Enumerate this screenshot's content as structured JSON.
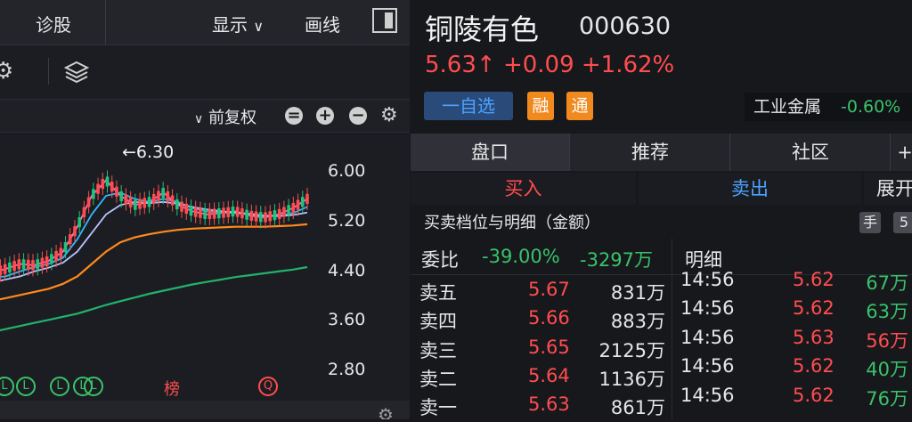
{
  "toolbar": {
    "diagnose_label": "诊股",
    "display_label": "显示",
    "draw_label": "画线",
    "price_adjust_label": "前复权"
  },
  "chart": {
    "high_label": "←6.30",
    "y_ticks": [
      "6.00",
      "5.20",
      "4.40",
      "3.60",
      "2.80"
    ],
    "event_markers": [
      "L",
      "L",
      "L",
      "L",
      "L",
      "榜",
      "Q"
    ]
  },
  "chart_data": {
    "type": "candlestick",
    "ylim": [
      2.8,
      6.4
    ],
    "y_ticks": [
      6.0,
      5.2,
      4.4,
      3.6,
      2.8
    ],
    "annotations": [
      "←6.30"
    ],
    "series": [
      {
        "values": [
          4.35,
          4.42,
          4.5,
          4.48,
          4.55,
          4.7,
          5.1,
          5.6,
          5.85,
          5.6,
          5.45,
          5.5,
          5.65,
          5.45,
          5.35,
          5.3,
          5.32,
          5.35,
          5.28,
          5.25,
          5.3,
          5.4,
          5.55
        ]
      },
      {
        "values": [
          4.28,
          4.3,
          4.38,
          4.45,
          4.5,
          4.6,
          4.9,
          5.3,
          5.6,
          5.65,
          5.55,
          5.5,
          5.55,
          5.5,
          5.4,
          5.35,
          5.33,
          5.32,
          5.3,
          5.27,
          5.28,
          5.32,
          5.42
        ]
      },
      {
        "values": [
          4.2,
          4.25,
          4.3,
          4.38,
          4.44,
          4.52,
          4.7,
          5.0,
          5.3,
          5.45,
          5.5,
          5.48,
          5.5,
          5.47,
          5.42,
          5.38,
          5.35,
          5.33,
          5.31,
          5.28,
          5.27,
          5.29,
          5.33
        ]
      },
      {
        "values": [
          3.9,
          3.95,
          4.0,
          4.05,
          4.1,
          4.18,
          4.3,
          4.5,
          4.7,
          4.85,
          4.93,
          4.98,
          5.02,
          5.05,
          5.07,
          5.08,
          5.09,
          5.1,
          5.1,
          5.1,
          5.11,
          5.12,
          5.14
        ]
      },
      {
        "values": [
          3.4,
          3.45,
          3.5,
          3.55,
          3.6,
          3.65,
          3.7,
          3.77,
          3.84,
          3.9,
          3.96,
          4.02,
          4.07,
          4.12,
          4.17,
          4.21,
          4.25,
          4.29,
          4.32,
          4.35,
          4.38,
          4.41,
          4.45
        ]
      }
    ]
  },
  "stock": {
    "name": "铜陵有色",
    "code": "000630",
    "price": "5.63",
    "change": "+0.09",
    "change_pct": "+1.62%",
    "price_line": "5.63↑ +0.09 +1.62%",
    "watch_label": "一自选",
    "tag_margin": "融",
    "tag_connect": "通",
    "sector_name": "工业金属",
    "sector_change": "-0.60%"
  },
  "tabs": [
    "盘口",
    "推荐",
    "社区",
    "+"
  ],
  "trade": {
    "buy": "买入",
    "sell": "卖出",
    "expand": "展开"
  },
  "detail": {
    "title": "买卖档位与明细（金额）",
    "hand_btn": "手",
    "five_btn": "5"
  },
  "order_book": {
    "ratio_label": "委比",
    "ratio_pct": "-39.00%",
    "ratio_amt": "-3297万",
    "rows": [
      {
        "label": "卖五",
        "price": "5.67",
        "amount": "831万"
      },
      {
        "label": "卖四",
        "price": "5.66",
        "amount": "883万"
      },
      {
        "label": "卖三",
        "price": "5.65",
        "amount": "2125万"
      },
      {
        "label": "卖二",
        "price": "5.64",
        "amount": "1136万"
      },
      {
        "label": "卖一",
        "price": "5.63",
        "amount": "861万"
      }
    ]
  },
  "ticks": {
    "title": "明细",
    "rows": [
      {
        "time": "14:56",
        "price": "5.62",
        "amount": "67万"
      },
      {
        "time": "14:56",
        "price": "5.62",
        "amount": "63万"
      },
      {
        "time": "14:56",
        "price": "5.63",
        "amount": "56万"
      },
      {
        "time": "14:56",
        "price": "5.62",
        "amount": "40万"
      },
      {
        "time": "14:56",
        "price": "5.62",
        "amount": "76万"
      }
    ]
  },
  "colors": {
    "up": "#ff4d4f",
    "down": "#3ac26a",
    "accent": "#4aa3ff"
  }
}
